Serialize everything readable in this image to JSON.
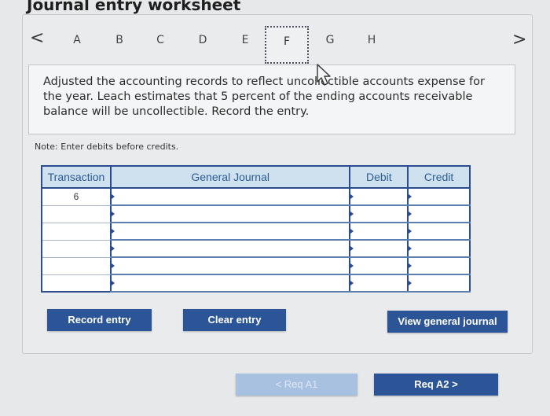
{
  "page": {
    "title": "Journal entry worksheet"
  },
  "nav": {
    "prev_symbol": "<",
    "next_symbol": ">",
    "tabs": [
      {
        "label": "A"
      },
      {
        "label": "B"
      },
      {
        "label": "C"
      },
      {
        "label": "D"
      },
      {
        "label": "E"
      },
      {
        "label": "F"
      },
      {
        "label": "G"
      },
      {
        "label": "H"
      }
    ],
    "active_tab": "F"
  },
  "instruction": {
    "text": "Adjusted the accounting records to reflect uncollectible accounts expense for the year. Leach estimates that 5 percent of the ending accounts receivable balance will be uncollectible. Record the entry."
  },
  "note": "Note: Enter debits before credits.",
  "table": {
    "headers": {
      "transaction": "Transaction",
      "journal": "General Journal",
      "debit": "Debit",
      "credit": "Credit"
    },
    "rows": [
      {
        "transaction": "6",
        "journal": "",
        "debit": "",
        "credit": ""
      },
      {
        "transaction": "",
        "journal": "",
        "debit": "",
        "credit": ""
      },
      {
        "transaction": "",
        "journal": "",
        "debit": "",
        "credit": ""
      },
      {
        "transaction": "",
        "journal": "",
        "debit": "",
        "credit": ""
      },
      {
        "transaction": "",
        "journal": "",
        "debit": "",
        "credit": ""
      },
      {
        "transaction": "",
        "journal": "",
        "debit": "",
        "credit": ""
      }
    ]
  },
  "buttons": {
    "record": "Record entry",
    "clear": "Clear entry",
    "view": "View general journal",
    "req_prev": "< Req A1",
    "req_next": "Req A2  >"
  },
  "colors": {
    "accent": "#2c5597",
    "header_bg": "#cfe0ee",
    "disabled": "#a9c1e1"
  }
}
